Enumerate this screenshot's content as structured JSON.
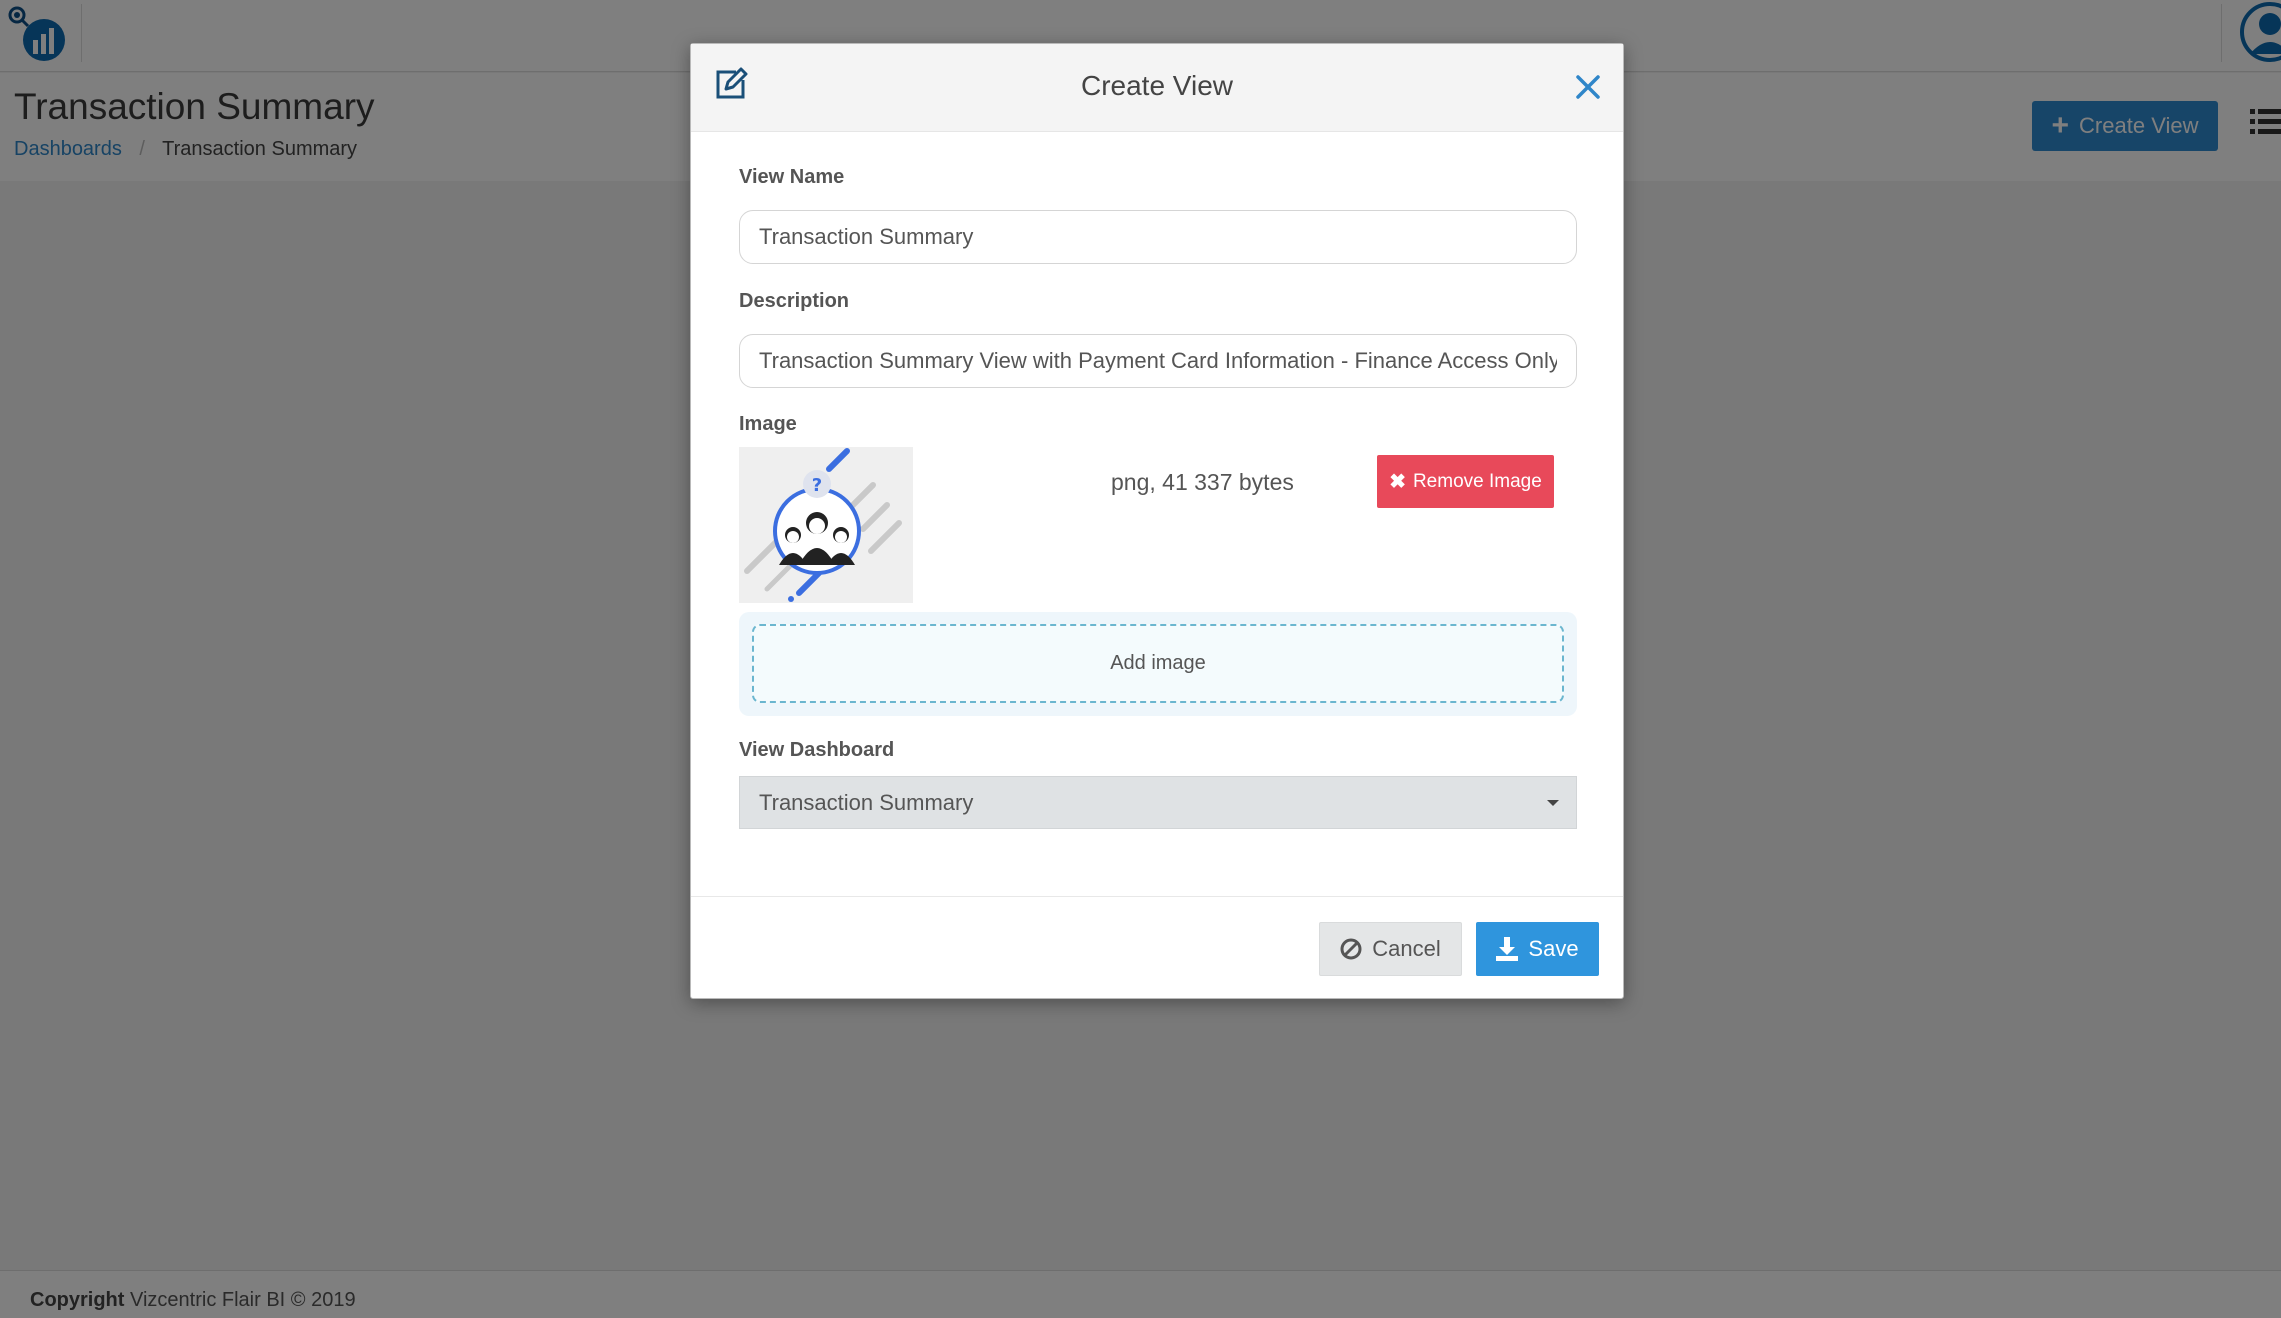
{
  "colors": {
    "accent": "#2f8ad0",
    "danger": "#e8495a",
    "link": "#2f86c9"
  },
  "header": {
    "logo_icon": "bar-chart-logo-icon",
    "avatar_icon": "user-avatar-icon"
  },
  "page": {
    "title": "Transaction Summary",
    "breadcrumb": {
      "parent": "Dashboards",
      "separator": "/",
      "current": "Transaction Summary"
    },
    "create_view_label": "Create View",
    "list_icon": "list-icon"
  },
  "modal": {
    "title": "Create View",
    "view_name": {
      "label": "View Name",
      "value": "Transaction Summary"
    },
    "description": {
      "label": "Description",
      "value": "Transaction Summary View with Payment Card Information - Finance Access Only"
    },
    "image": {
      "label": "Image",
      "file_info": "png, 41 337 bytes",
      "remove_label": "Remove Image",
      "add_label": "Add image"
    },
    "view_dashboard": {
      "label": "View Dashboard",
      "selected": "Transaction Summary"
    },
    "cancel_label": "Cancel",
    "save_label": "Save"
  },
  "footer": {
    "copyright_label": "Copyright",
    "copyright_text": "Vizcentric Flair BI © 2019"
  }
}
